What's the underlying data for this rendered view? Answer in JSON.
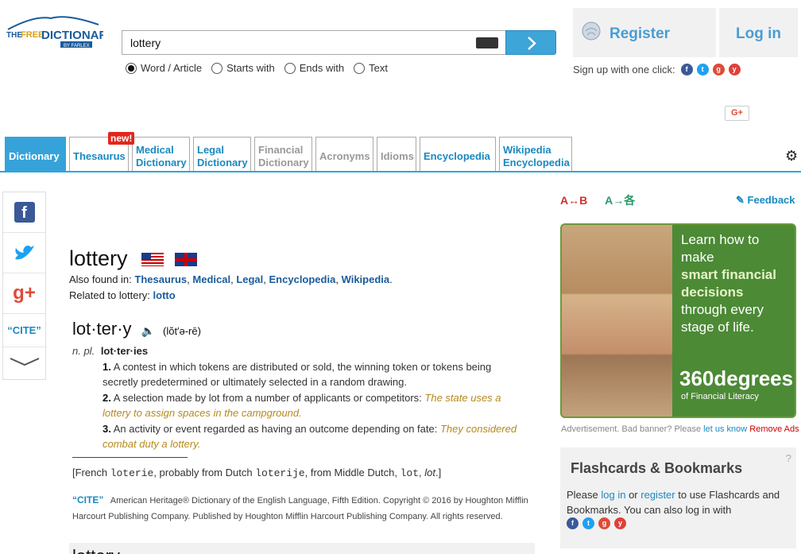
{
  "header": {
    "logo_text": "THE FREE DICTIONARY BY FARLEX",
    "search_value": "lottery",
    "radio_options": [
      {
        "label": "Word / Article",
        "checked": true
      },
      {
        "label": "Starts with",
        "checked": false
      },
      {
        "label": "Ends with",
        "checked": false
      },
      {
        "label": "Text",
        "checked": false
      }
    ],
    "register_label": "Register",
    "login_label": "Log in",
    "signup_text": "Sign up with one click:"
  },
  "tabs": [
    {
      "label": "Dictionary",
      "active": true
    },
    {
      "label": "Thesaurus"
    },
    {
      "label": "Medical Dictionary"
    },
    {
      "label": "Legal Dictionary"
    },
    {
      "label": "Financial Dictionary",
      "dim": true
    },
    {
      "label": "Acronyms",
      "dim": true
    },
    {
      "label": "Idioms",
      "dim": true
    },
    {
      "label": "Encyclopedia"
    },
    {
      "label": "Wikipedia Encyclopedia"
    }
  ],
  "new_badge": "new!",
  "share": {
    "cite_label": "“CITE”"
  },
  "entry": {
    "title": "lottery",
    "also_found_label": "Also found in:",
    "also_found": [
      "Thesaurus",
      "Medical",
      "Legal",
      "Encyclopedia",
      "Wikipedia"
    ],
    "related_label": "Related to lottery:",
    "related": "lotto",
    "headword": "lot·ter·y",
    "pronunciation": "(lŏt′ə-rē)",
    "pos": "n. pl.",
    "plural": "lot·ter·ies",
    "senses": [
      {
        "num": "1.",
        "text": "A contest in which tokens are distributed or sold, the winning token or tokens being secretly predetermined or ultimately selected in a random drawing.",
        "example": ""
      },
      {
        "num": "2.",
        "text": "A selection made by lot from a number of applicants or competitors:",
        "example": "The state uses a lottery to assign spaces in the campground."
      },
      {
        "num": "3.",
        "text": "An activity or event regarded as having an outcome depending on fate:",
        "example": "They considered combat duty a lottery."
      }
    ],
    "etym_pre": "[French",
    "etym_w1": "loterie",
    "etym_mid1": ", probably from Dutch",
    "etym_w2": "loterije",
    "etym_mid2": ", from Middle Dutch,",
    "etym_w3": "lot",
    "etym_end": ".]",
    "cite_label": "“CITE”",
    "copyright": "American Heritage® Dictionary of the English Language, Fifth Edition. Copyright © 2016 by Houghton Mifflin Harcourt Publishing Company. Published by Houghton Mifflin Harcourt Publishing Company. All rights reserved.",
    "next_word": "lottery"
  },
  "sidebar": {
    "feedback_label": "Feedback",
    "ad": {
      "line1": "Learn how to make",
      "line2": "smart financial decisions",
      "line3": "through every stage of life.",
      "logo": "360degrees",
      "sub": "of Financial Literacy"
    },
    "ad_note": "Advertisement. Bad banner? Please",
    "ad_link": "let us know",
    "ad_remove": "Remove Ads",
    "flashcards_title": "Flashcards & Bookmarks",
    "flashcards_q": "?",
    "fc_please": "Please",
    "fc_login": "log in",
    "fc_or": "or",
    "fc_register": "register",
    "fc_rest": "to use Flashcards and Bookmarks. You can also log in with"
  }
}
